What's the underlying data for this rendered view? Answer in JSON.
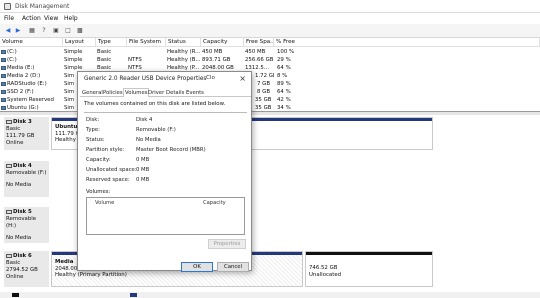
{
  "window": {
    "title": "Disk Management"
  },
  "menu": [
    "File",
    "Action",
    "View",
    "Help"
  ],
  "volume_table": {
    "headers": [
      "Volume",
      "Layout",
      "Type",
      "File System",
      "Status",
      "Capacity",
      "Free Spa...",
      "% Free"
    ],
    "rows": [
      [
        "(C:)",
        "Simple",
        "Basic",
        "",
        "Healthy (R...",
        "450 MB",
        "450 MB",
        "100 %"
      ],
      [
        "(C:)",
        "Simple",
        "Basic",
        "NTFS",
        "Healthy (B...",
        "893.71 GB",
        "256.66 GB",
        "29 %"
      ],
      [
        "Media (E:)",
        "Simple",
        "Basic",
        "NTFS",
        "Healthy (P...",
        "2048.00 GB",
        "1312.5...",
        "64 %"
      ],
      [
        "Media 2 (D:)",
        "Sim",
        "",
        "",
        "",
        "",
        "1.72 GB",
        "8 %"
      ],
      [
        "RADStudio (E:)",
        "Sim",
        "",
        "",
        "",
        "",
        "7 GB",
        "89 %"
      ],
      [
        "SSD 2 (F:)",
        "Sim",
        "",
        "",
        "",
        "",
        "8 GB",
        "64 %"
      ],
      [
        "System Reserved",
        "Sim",
        "",
        "",
        "",
        "",
        "35 GB",
        "42 %"
      ],
      [
        "Ubuntu (G:)",
        "Sim",
        "",
        "",
        "",
        "",
        "35 GB",
        "34 %"
      ]
    ]
  },
  "disks": [
    {
      "name": "Disk 3",
      "type": "Basic",
      "size": "111.79 GB",
      "state": "Online",
      "partition": {
        "name": "Ubuntu",
        "size": "111.79 GB",
        "status": "Healthy"
      }
    },
    {
      "name": "Disk 4",
      "type": "Removable (F:)",
      "size": "",
      "state": "No Media"
    },
    {
      "name": "Disk 5",
      "type": "Removable (H:)",
      "size": "",
      "state": "No Media"
    },
    {
      "name": "Disk 6",
      "type": "Basic",
      "size": "2794.52 GB",
      "state": "Online",
      "partition": {
        "name": "Media",
        "size": "2048.00",
        "status": "Healthy (Primary Partition)"
      },
      "unallocated": {
        "size": "746.52 GB",
        "label": "Unallocated"
      }
    }
  ],
  "dialog": {
    "title": "Generic 2.0 Reader  USB Device Properties",
    "extra": "Clo",
    "tabs": [
      "General",
      "Policies",
      "Volumes",
      "Driver",
      "Details",
      "Events"
    ],
    "intro": "The volumes contained on this disk are listed below.",
    "props": [
      {
        "label": "Disk:",
        "value": "Disk 4"
      },
      {
        "label": "Type:",
        "value": "Removable (F:)"
      },
      {
        "label": "Status:",
        "value": "No Media"
      },
      {
        "label": "Partition style:",
        "value": "Master Boot Record (MBR)"
      },
      {
        "label": "Capacity:",
        "value": "0 MB"
      },
      {
        "label": "Unallocated space:",
        "value": "0 MB"
      },
      {
        "label": "Reserved space:",
        "value": "0 MB"
      }
    ],
    "volumes_label": "Volumes:",
    "volumes_headers": [
      "Volume",
      "Capacity"
    ],
    "properties_button": "Properties",
    "ok": "OK",
    "cancel": "Cancel"
  },
  "colors": {
    "primary_partition": "#24397d",
    "unallocated": "#111111"
  }
}
